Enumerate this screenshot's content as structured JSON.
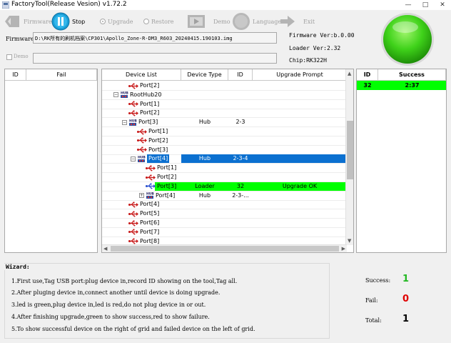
{
  "window": {
    "title": "FactoryTool(Release Vesion) v1.72.2",
    "minimize": "—",
    "maximize": "□",
    "close": "✕"
  },
  "toolbar": {
    "firmware": "Firmware",
    "stop": "Stop",
    "upgrade": "Upgrade",
    "restore": "Restore",
    "demo": "Demo",
    "language": "Language",
    "exit": "Exit"
  },
  "firmware": {
    "label": "Firmware",
    "path": "D:\\RK所有的刷机档案\\CP301\\Apollo_Zone-R-DM3_R603_20240415.190103.img",
    "demo_label": "Demo",
    "demo_path": ""
  },
  "info": {
    "firmware_ver": "Firmware Ver:b.0.00",
    "loader_ver": "Loader Ver:2.32",
    "chip": "Chip:RK322H"
  },
  "fail_grid": {
    "col_id": "ID",
    "col_fail": "Fail"
  },
  "device_grid": {
    "columns": [
      "Device List",
      "Device Type",
      "ID",
      "Upgrade Prompt"
    ],
    "rows": [
      {
        "name": "Port[2]",
        "type": "",
        "id": "",
        "prompt": "",
        "icon": "usb",
        "indent": 2,
        "expand": ""
      },
      {
        "name": "RootHub20",
        "type": "",
        "id": "",
        "prompt": "",
        "icon": "hub",
        "indent": 1,
        "expand": "-"
      },
      {
        "name": "Port[1]",
        "type": "",
        "id": "",
        "prompt": "",
        "icon": "usb",
        "indent": 2,
        "expand": ""
      },
      {
        "name": "Port[2]",
        "type": "",
        "id": "",
        "prompt": "",
        "icon": "usb",
        "indent": 2,
        "expand": ""
      },
      {
        "name": "Port[3]",
        "type": "Hub",
        "id": "2-3",
        "prompt": "",
        "icon": "hub",
        "indent": 2,
        "expand": "-"
      },
      {
        "name": "Port[1]",
        "type": "",
        "id": "",
        "prompt": "",
        "icon": "usb",
        "indent": 3,
        "expand": ""
      },
      {
        "name": "Port[2]",
        "type": "",
        "id": "",
        "prompt": "",
        "icon": "usb",
        "indent": 3,
        "expand": ""
      },
      {
        "name": "Port[3]",
        "type": "",
        "id": "",
        "prompt": "",
        "icon": "usb",
        "indent": 3,
        "expand": ""
      },
      {
        "name": "Port[4]",
        "type": "Hub",
        "id": "2-3-4",
        "prompt": "",
        "icon": "hub",
        "indent": 3,
        "expand": "-",
        "state": "selected"
      },
      {
        "name": "Port[1]",
        "type": "",
        "id": "",
        "prompt": "",
        "icon": "usb",
        "indent": 4,
        "expand": ""
      },
      {
        "name": "Port[2]",
        "type": "",
        "id": "",
        "prompt": "",
        "icon": "usb",
        "indent": 4,
        "expand": ""
      },
      {
        "name": "Port[3]",
        "type": "Loader",
        "id": "32",
        "prompt": "Upgrade OK",
        "icon": "usb-blue",
        "indent": 4,
        "expand": "",
        "state": "ok"
      },
      {
        "name": "Port[4]",
        "type": "Hub",
        "id": "2-3-...",
        "prompt": "",
        "icon": "hub",
        "indent": 4,
        "expand": "+"
      },
      {
        "name": "Port[4]",
        "type": "",
        "id": "",
        "prompt": "",
        "icon": "usb",
        "indent": 2,
        "expand": ""
      },
      {
        "name": "Port[5]",
        "type": "",
        "id": "",
        "prompt": "",
        "icon": "usb",
        "indent": 2,
        "expand": ""
      },
      {
        "name": "Port[6]",
        "type": "",
        "id": "",
        "prompt": "",
        "icon": "usb",
        "indent": 2,
        "expand": ""
      },
      {
        "name": "Port[7]",
        "type": "",
        "id": "",
        "prompt": "",
        "icon": "usb",
        "indent": 2,
        "expand": ""
      },
      {
        "name": "Port[8]",
        "type": "",
        "id": "",
        "prompt": "",
        "icon": "usb",
        "indent": 2,
        "expand": ""
      }
    ]
  },
  "success_grid": {
    "col_id": "ID",
    "col_success": "Success",
    "rows": [
      {
        "id": "32",
        "time": "2:37"
      }
    ]
  },
  "wizard": {
    "title": "Wizard:",
    "lines": [
      "1.First use,Tag USB port:plug device in,record ID showing on the tool,Tag all.",
      "2.After pluging device in,connect another until device is doing upgrade.",
      "3.led is green,plug device in,led is red,do not plug device in or out.",
      "4.After finishing upgrade,green to show success,red to show failure.",
      "5.To show successful device on the right of grid and failed device on the left of grid."
    ]
  },
  "stats": {
    "success_label": "Success:",
    "success_value": "1",
    "fail_label": "Fail:",
    "fail_value": "0",
    "total_label": "Total:",
    "total_value": "1"
  },
  "colors": {
    "success_green": "#00ff00",
    "selection_blue": "#0b70d0",
    "success_text": "#22b822",
    "fail_text": "#e00000"
  }
}
